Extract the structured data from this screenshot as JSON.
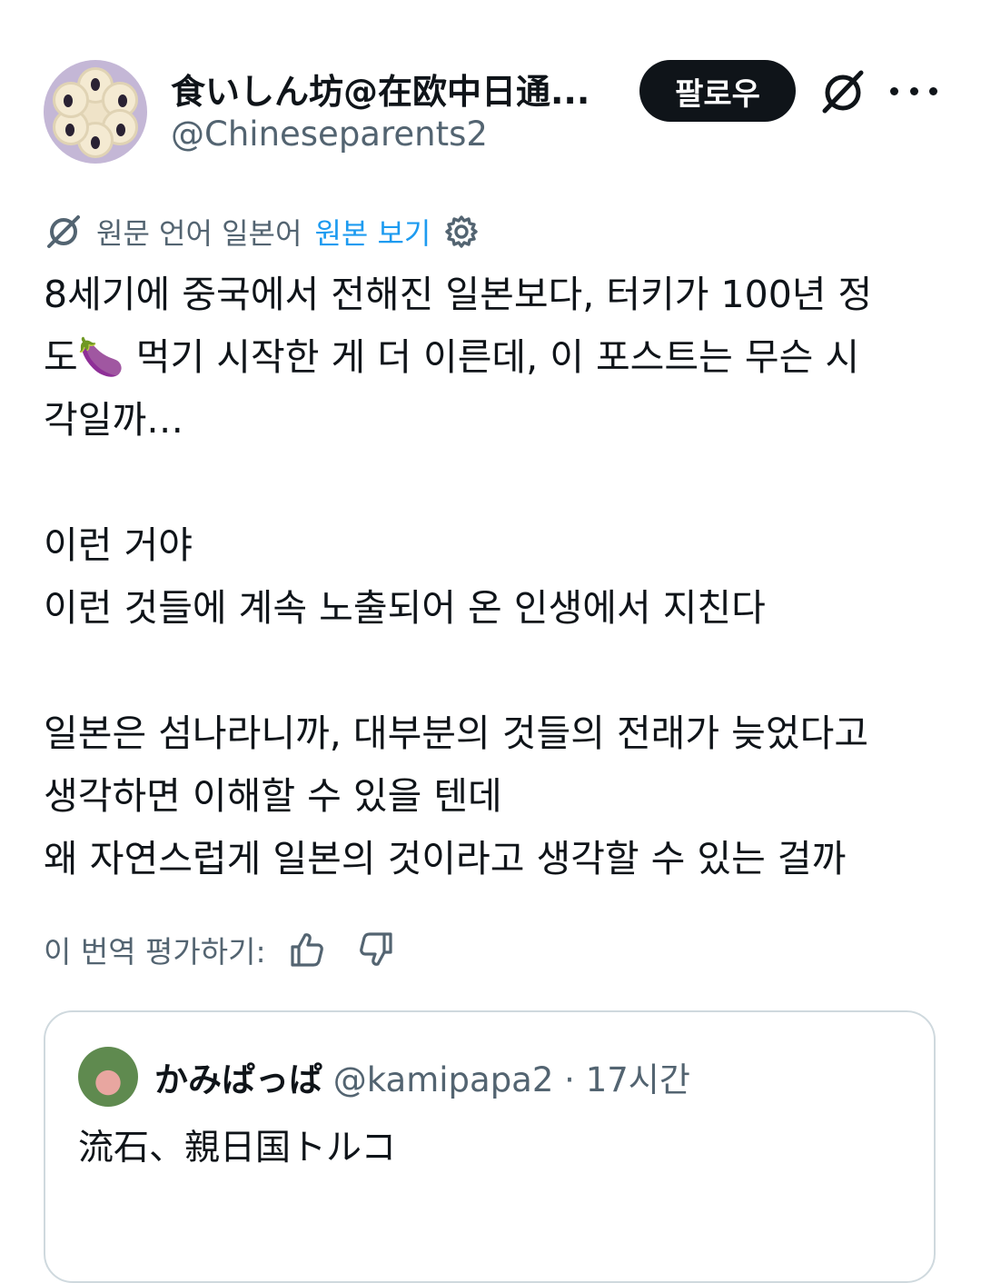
{
  "author": {
    "display_name": "食いしん坊@在欧中日通...",
    "handle": "@Chineseparents2",
    "follow_label": "팔로우"
  },
  "translation": {
    "source_label": "원문 언어 일본어",
    "view_original": "원본 보기"
  },
  "post": {
    "lines": [
      "8세기에 중국에서 전해진 일본보다, 터키가 100년 정",
      "도🍆 먹기 시작한 게 더 이른데, 이 포스트는 무슨 시",
      "각일까…",
      "",
      "이런 거야",
      "이런 것들에 계속 노출되어 온 인생에서 지친다",
      "",
      "일본은 섬나라니까, 대부분의 것들의 전래가 늦었다고",
      "생각하면 이해할 수 있을 텐데",
      "왜 자연스럽게 일본의 것이라고 생각할 수 있는 걸까"
    ]
  },
  "rating": {
    "label": "이 번역 평가하기:"
  },
  "quote": {
    "name": "かみぱっぱ",
    "handle": "@kamipapa2",
    "separator": "·",
    "time": "17시간",
    "text": "流石、親日国トルコ"
  },
  "icons": {
    "grok": "grok-icon",
    "more": "more-dots-icon",
    "translate": "grok-translate-icon",
    "settings": "gear-icon",
    "thumbs_up": "thumbs-up-icon",
    "thumbs_down": "thumbs-down-icon"
  },
  "colors": {
    "text": "#0f1419",
    "muted": "#536471",
    "link": "#1d9bf0",
    "border": "#cfd9de"
  }
}
